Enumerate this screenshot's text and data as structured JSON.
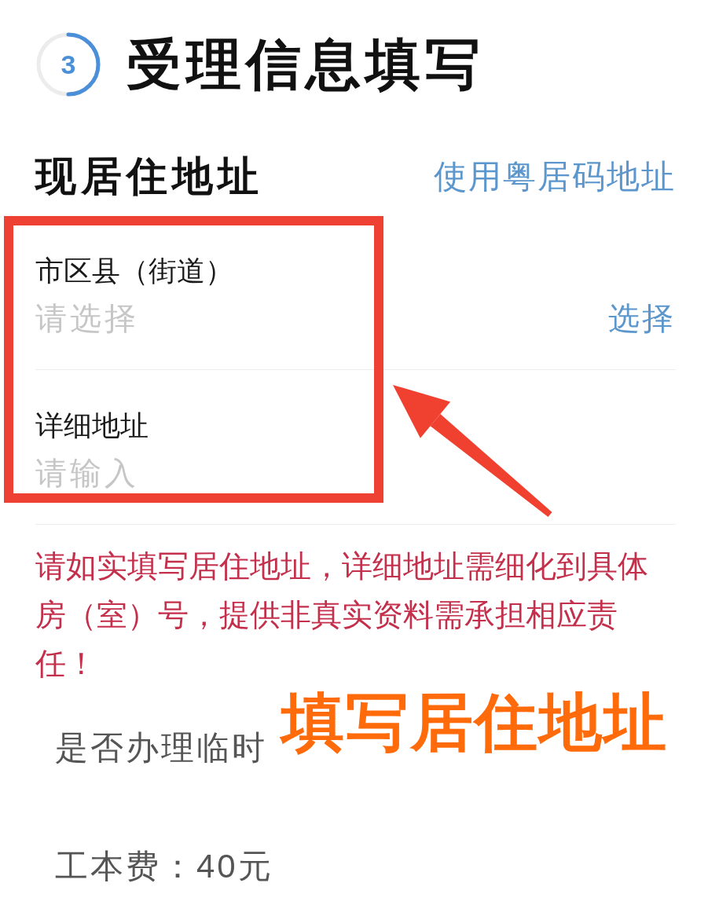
{
  "step": {
    "number": "3",
    "level": 0.5,
    "title": "受理信息填写"
  },
  "section": {
    "title": "现居住地址",
    "link": "使用粤居码地址"
  },
  "fields": [
    {
      "kind": "select",
      "label": "市区县（街道）",
      "placeholder": "请选择",
      "action": "选择"
    },
    {
      "kind": "text",
      "label": "详细地址",
      "placeholder": "请输入"
    }
  ],
  "notice": "请如实填写居住地址，详细地址需细化到具体房（室）号，提供非真实资料需承担相应责任！",
  "rows": [
    "是否办理临时",
    "工本费：40元"
  ],
  "annotation": {
    "text": "填写居住地址"
  }
}
